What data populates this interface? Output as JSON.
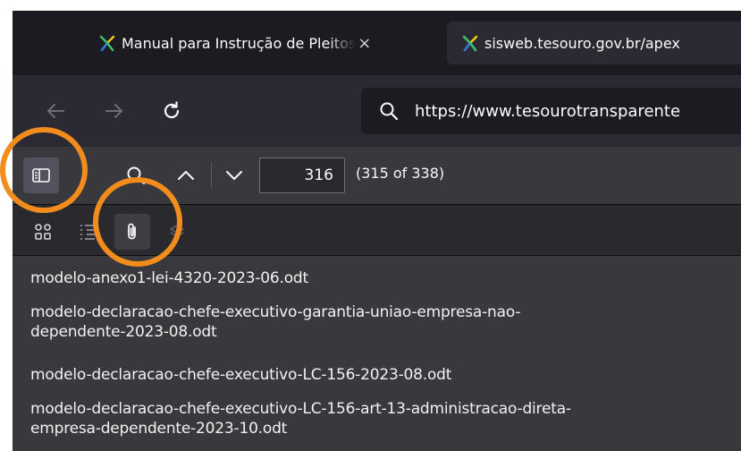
{
  "tabs": [
    {
      "label": "Manual para Instrução de Pleitos",
      "close": "×",
      "active": true
    },
    {
      "label": "sisweb.tesouro.gov.br/apex",
      "active": false
    }
  ],
  "nav": {
    "back_icon": "back-arrow-icon",
    "forward_icon": "forward-arrow-icon",
    "reload_icon": "reload-icon",
    "url": "https://www.tesourotransparente"
  },
  "pdf_toolbar": {
    "page_number": "316",
    "page_count": "(315 of 338)"
  },
  "sidebar_views": [
    "thumbnails-icon",
    "outline-icon",
    "attachments-icon",
    "layers-icon"
  ],
  "attachments": [
    "modelo-anexo1-lei-4320-2023-06.odt",
    "modelo-declaracao-chefe-executivo-garantia-uniao-empresa-nao-\ndependente-2023-08.odt",
    "modelo-declaracao-chefe-executivo-LC-156-2023-08.odt",
    "modelo-declaracao-chefe-executivo-LC-156-art-13-administracao-direta-\nempresa-dependente-2023-10.odt"
  ],
  "colors": {
    "annotation": "#f28c1c",
    "tab_strip": "#1c1b22",
    "toolbar": "#38383d"
  }
}
